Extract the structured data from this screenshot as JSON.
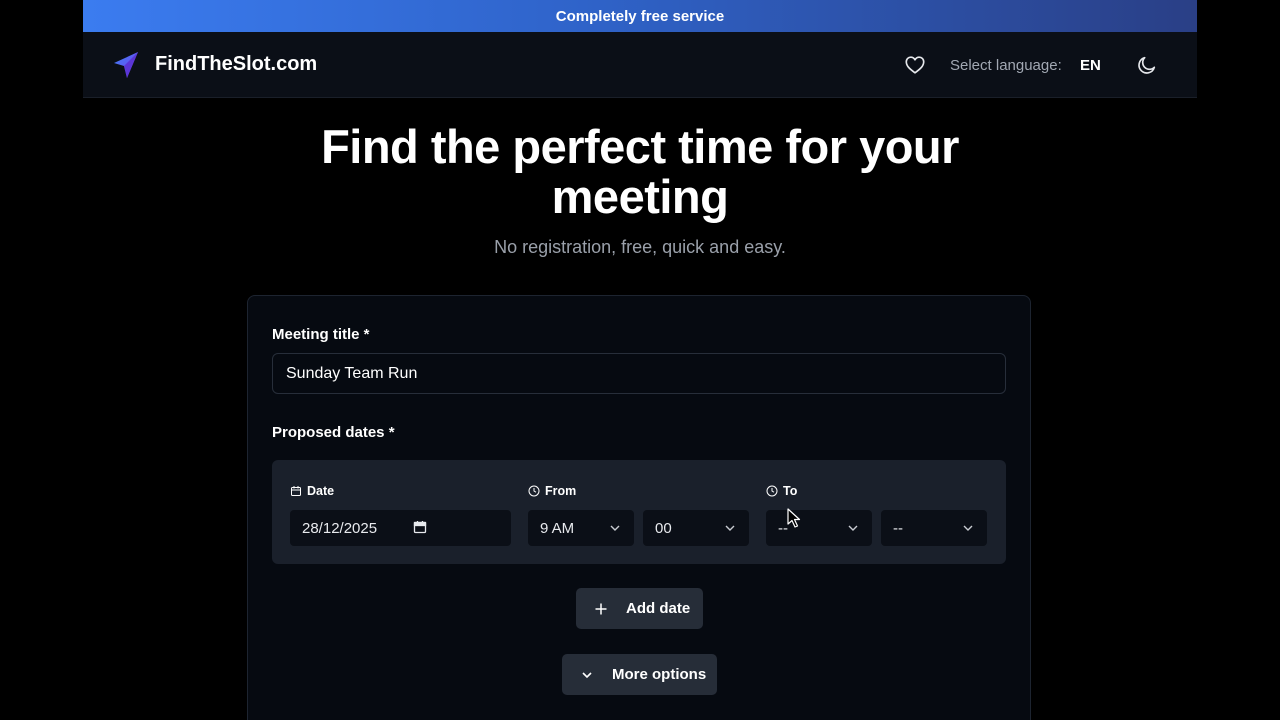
{
  "banner": {
    "text": "Completely free service"
  },
  "nav": {
    "brand": "FindTheSlot.com",
    "language_label": "Select language:",
    "language_value": "EN"
  },
  "hero": {
    "title_line1": "Find the perfect time for your",
    "title_line2": "meeting",
    "subtitle": "No registration, free, quick and easy."
  },
  "form": {
    "meeting_title_label": "Meeting title *",
    "meeting_title_value": "Sunday Team Run",
    "proposed_dates_label": "Proposed dates *",
    "date_row": {
      "date_label": "Date",
      "date_value": "28/12/2025",
      "from_label": "From",
      "from_hour": "9 AM",
      "from_minute": "00",
      "to_label": "To",
      "to_hour": "--",
      "to_minute": "--"
    },
    "add_date_label": "Add date",
    "more_options_label": "More options"
  },
  "colors": {
    "banner_gradient_start": "#3b7cf0",
    "banner_gradient_end": "#2a3f86",
    "background": "#000000",
    "card": "#060a11",
    "date_row_bg": "#1a202b",
    "button_bg": "#262d38"
  },
  "icons": [
    "paper-plane-logo-icon",
    "heart-icon",
    "moon-icon",
    "calendar-icon",
    "clock-icon",
    "chevron-down-icon",
    "plus-icon",
    "mouse-pointer-icon"
  ]
}
